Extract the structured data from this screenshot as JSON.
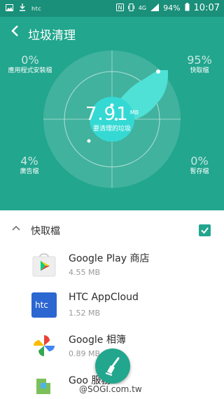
{
  "status_bar": {
    "carrier": "htc",
    "battery": "94%",
    "time": "10:07",
    "network": "4G"
  },
  "header": {
    "title": "垃圾清理",
    "back_icon": "arrow-left-icon"
  },
  "summary": {
    "total_value": "7.91",
    "total_unit": "MB",
    "total_label": "要清理的垃圾",
    "app_install_pct": "0%",
    "app_install_label": "應用程式安裝檔",
    "cache_pct": "95%",
    "cache_label": "快取檔",
    "ads_pct": "4%",
    "ads_label": "廣告檔",
    "temp_pct": "0%",
    "temp_label": "暫存檔"
  },
  "section": {
    "title": "快取檔",
    "checked": true
  },
  "apps": [
    {
      "name": "Google Play 商店",
      "size": "4.55 MB",
      "icon": "google-play-store-icon"
    },
    {
      "name": "HTC AppCloud",
      "size": "1.52 MB",
      "icon": "htc-icon",
      "icon_text": "htc"
    },
    {
      "name": "Google 相簿",
      "size": "0.89 MB",
      "icon": "google-photos-icon"
    },
    {
      "name": "Goo 服務",
      "size": "",
      "icon": "google-play-services-icon",
      "partial": true
    }
  ],
  "fab": {
    "icon": "broom-icon"
  },
  "watermark": "@SOGI.com.tw",
  "colors": {
    "primary": "#22a68e",
    "status_bar": "#1a8f79",
    "blob": "#4fe0d6",
    "center": "#35d9d4"
  }
}
